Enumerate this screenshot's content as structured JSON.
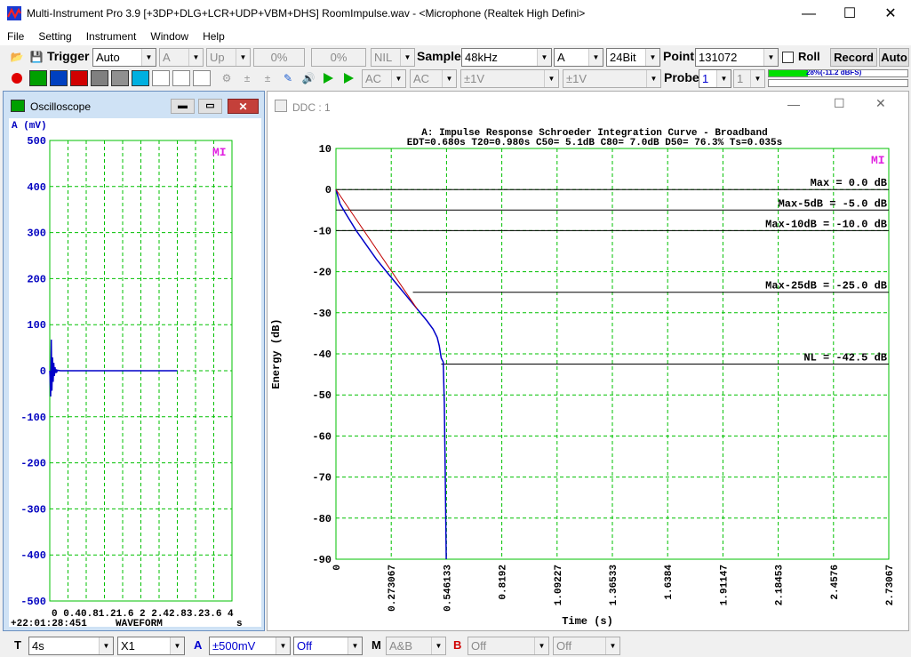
{
  "window": {
    "title": "Multi-Instrument Pro 3.9    [+3DP+DLG+LCR+UDP+VBM+DHS]    RoomImpulse.wav   -   <Microphone (Realtek High Defini>",
    "minimize": "—",
    "maximize": "☐",
    "close": "✕"
  },
  "menu": [
    "File",
    "Setting",
    "Instrument",
    "Window",
    "Help"
  ],
  "toolbar1": {
    "trigger_label": "Trigger",
    "trigger_mode": "Auto",
    "trigger_channel": "A",
    "trigger_edge": "Up",
    "pct1": "0%",
    "pct2": "0%",
    "nil": "NIL",
    "sample_label": "Sample",
    "sample_rate": "48kHz",
    "channel": "A",
    "bits": "24Bit",
    "point_label": "Point",
    "points": "131072",
    "roll_label": "Roll",
    "record_label": "Record",
    "auto_label": "Auto"
  },
  "toolbar2": {
    "coupling_a": "AC",
    "coupling_b": "AC",
    "range_a": "±1V",
    "range_b": "±1V",
    "probe_label": "Probe",
    "probe_a": "1",
    "probe_b": "1",
    "level_text": "28%(-11.2 dBFS)",
    "level_fraction": 0.28,
    "level_color": "#00e000"
  },
  "oscilloscope": {
    "title": "Oscilloscope",
    "unit_label": "A (mV)",
    "mi_logo": "MI",
    "y_ticks": [
      "500",
      "400",
      "300",
      "200",
      "100",
      "0",
      "-100",
      "-200",
      "-300",
      "-400",
      "-500"
    ],
    "x_ticks": "0 0.40.81.21.6 2 2.42.83.23.6 4",
    "x_unit": "s",
    "timestamp": "+22:01:28:451",
    "mode_label": "WAVEFORM",
    "trace_color": "#0000c8",
    "grid_color": "#00c000"
  },
  "ddc": {
    "title": "DDC : 1",
    "plot_title": "A: Impulse Response Schroeder Integration Curve - Broadband",
    "metrics": "EDT=0.680s   T20=0.980s   C50=  5.1dB   C80=  7.0dB   D50= 76.3%   Ts=0.035s",
    "mi_logo": "MI",
    "ylabel": "Energy (dB)",
    "xlabel": "Time (s)",
    "y_ticks": [
      "10",
      "0",
      "-10",
      "-20",
      "-30",
      "-40",
      "-50",
      "-60",
      "-70",
      "-80",
      "-90"
    ],
    "x_ticks": [
      "0",
      "0.273067",
      "0.546133",
      "0.8192",
      "1.09227",
      "1.36533",
      "1.6384",
      "1.91147",
      "2.18453",
      "2.4576",
      "2.73067"
    ],
    "ref_lines": [
      {
        "label": "Max =   0.0  dB",
        "db": 0
      },
      {
        "label": "Max-5dB  =  -5.0  dB",
        "db": -5
      },
      {
        "label": "Max-10dB = -10.0  dB",
        "db": -10
      },
      {
        "label": "Max-25dB = -25.0  dB",
        "db": -25
      },
      {
        "label": "NL = -42.5  dB",
        "db": -42.5
      }
    ],
    "curve_color": "#0000c8",
    "fit_color": "#c00000"
  },
  "chart_data": {
    "type": "line",
    "title": "A: Impulse Response Schroeder Integration Curve - Broadband",
    "xlabel": "Time (s)",
    "ylabel": "Energy (dB)",
    "xlim": [
      0,
      2.73067
    ],
    "ylim": [
      -90,
      10
    ],
    "grid": true,
    "series": [
      {
        "x": [
          0,
          0.02,
          0.05,
          0.1,
          0.15,
          0.2,
          0.25,
          0.3,
          0.35,
          0.4,
          0.45,
          0.48,
          0.5,
          0.51,
          0.52,
          0.53,
          0.535,
          0.54,
          0.545
        ],
        "y": [
          0,
          -3.5,
          -6,
          -10,
          -13.5,
          -17,
          -20,
          -23,
          -26,
          -29,
          -32,
          -34,
          -36,
          -38,
          -41,
          -42,
          -52,
          -70,
          -90
        ]
      }
    ]
  },
  "statusbar": {
    "t_label": "T",
    "time_base": "4s",
    "multiplier": "X1",
    "a_label": "A",
    "a_range": "±500mV",
    "a_off": "Off",
    "m_label": "M",
    "m_mode": "A&B",
    "b_label": "B",
    "b_off": "Off",
    "b_off2": "Off"
  }
}
